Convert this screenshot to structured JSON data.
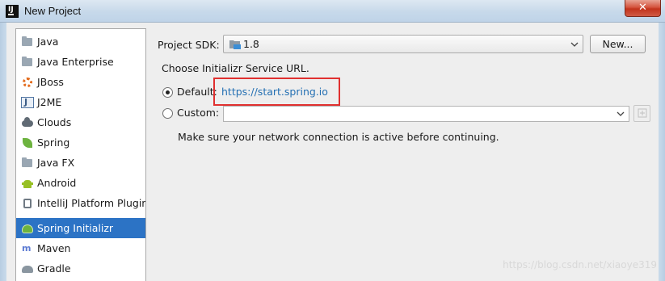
{
  "window": {
    "title": "New Project",
    "close_label": "✕",
    "app_icon_label": "IJ"
  },
  "sidebar": {
    "items": [
      {
        "label": "Java",
        "icon": "folder-icon"
      },
      {
        "label": "Java Enterprise",
        "icon": "folder-icon"
      },
      {
        "label": "JBoss",
        "icon": "jboss-icon"
      },
      {
        "label": "J2ME",
        "icon": "j2me-icon"
      },
      {
        "label": "Clouds",
        "icon": "cloud-icon"
      },
      {
        "label": "Spring",
        "icon": "spring-leaf-icon"
      },
      {
        "label": "Java FX",
        "icon": "folder-icon"
      },
      {
        "label": "Android",
        "icon": "android-icon"
      },
      {
        "label": "IntelliJ Platform Plugin",
        "icon": "plugin-icon"
      },
      {
        "label": "Spring Initializr",
        "icon": "spring-initializr-icon",
        "selected": true
      },
      {
        "label": "Maven",
        "icon": "maven-icon"
      },
      {
        "label": "Gradle",
        "icon": "gradle-icon"
      }
    ]
  },
  "sdk": {
    "label": "Project SDK:",
    "value": "1.8",
    "new_button": "New..."
  },
  "service": {
    "heading": "Choose Initializr Service URL.",
    "default_label": "Default:",
    "default_url": "https://start.spring.io",
    "custom_label": "Custom:",
    "custom_value": "",
    "note": "Make sure your network connection is active before continuing."
  },
  "watermark": "https://blog.csdn.net/xiaoye319",
  "colors": {
    "selection": "#2c73c5",
    "link": "#2470b3",
    "highlight": "#e0302f"
  }
}
